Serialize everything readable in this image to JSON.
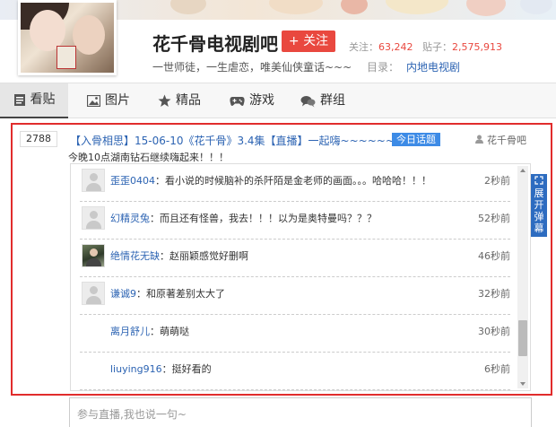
{
  "header": {
    "forum_name": "花千骨电视剧吧",
    "follow_label": "+ 关注",
    "stats": {
      "follow_label": "关注：",
      "follow_count": "63,242",
      "post_label": "贴子：",
      "post_count": "2,575,913"
    },
    "slogan": "一世师徒，一生虐恋，唯美仙侠童话~~~",
    "catalog_label": "目录：",
    "catalog_link": "内地电视剧"
  },
  "nav": {
    "tabs": [
      {
        "label": "看贴",
        "icon": "document-icon",
        "active": true
      },
      {
        "label": "图片",
        "icon": "image-icon",
        "active": false
      },
      {
        "label": "精品",
        "icon": "star-icon",
        "active": false
      },
      {
        "label": "游戏",
        "icon": "gamepad-icon",
        "active": false
      },
      {
        "label": "群组",
        "icon": "chat-bubbles-icon",
        "active": false
      }
    ]
  },
  "live": {
    "count": "2788",
    "title": "【入骨相思】15-06-10《花千骨》3.4集【直播】一起嗨~~~~~~~~~~~",
    "badge": "今日话题",
    "author": "花千骨吧",
    "subtitle": "今晚10点湖南钻石继续嗨起来！！！",
    "side_tab_label": [
      "展",
      "开",
      "弹",
      "幕"
    ],
    "comments": [
      {
        "user": "歪歪0404",
        "text": "看小说的时候脑补的杀阡陌是金老师的画面。。。哈哈哈！！！",
        "time": "2秒前",
        "avatar": "default"
      },
      {
        "user": "幻精灵兔",
        "text": "而且还有怪兽，我去！！！以为是奥特曼吗？？？",
        "time": "52秒前",
        "avatar": "default"
      },
      {
        "user": "绝情花无缺",
        "text": "赵丽颖感觉好删啊",
        "time": "46秒前",
        "avatar": "photo"
      },
      {
        "user": "谦诚9",
        "text": "和原著差别太大了",
        "time": "32秒前",
        "avatar": "default"
      },
      {
        "user": "离月舒儿",
        "text": "萌萌哒",
        "time": "30秒前",
        "avatar": "none"
      },
      {
        "user": "liuying916",
        "text": "挺好看的",
        "time": "6秒前",
        "avatar": "none"
      }
    ],
    "scroll_position": 0.86,
    "reply_placeholder": "参与直播,我也说一句~"
  },
  "colors": {
    "accent_red": "#e12c2c",
    "link_blue": "#2d64b3",
    "badge_blue": "#3d8be6",
    "follow_red": "#e9483f"
  }
}
